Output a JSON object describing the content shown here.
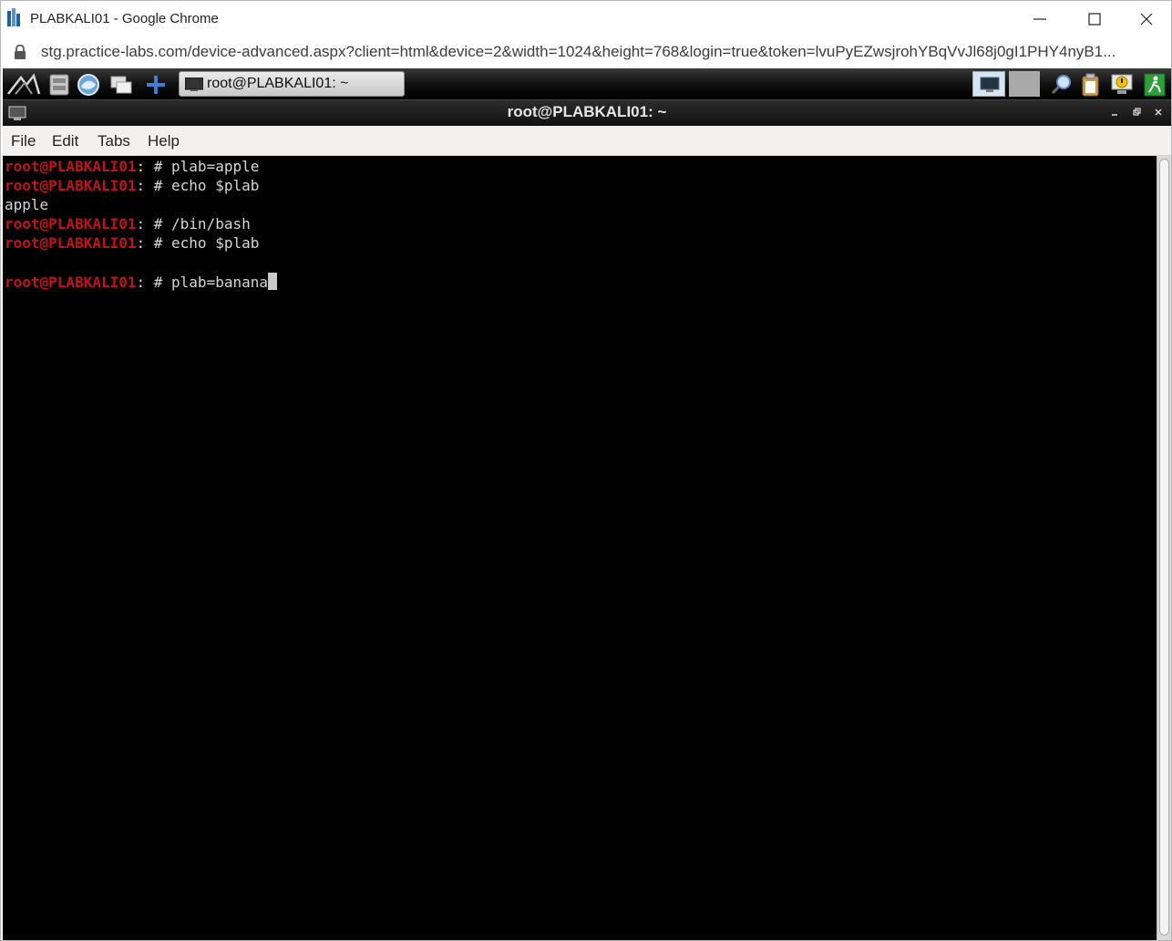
{
  "browser": {
    "window_title": "PLABKALI01 - Google Chrome",
    "url": "stg.practice-labs.com/device-advanced.aspx?client=html&device=2&width=1024&height=768&login=true&token=lvuPyEZwsjrohYBqVvJl68j0gI1PHY4nyB1..."
  },
  "taskbar": {
    "task_label": "root@PLABKALI01: ~",
    "icons": [
      "kali-menu-icon",
      "file-manager-icon",
      "browser-icon",
      "show-desktop-icon",
      "add-icon"
    ],
    "tray_icons": [
      "monitor-icon",
      "search-icon",
      "clipboard-icon",
      "alert-icon",
      "exit-icon"
    ]
  },
  "terminal_window": {
    "title": "root@PLABKALI01: ~",
    "menu": [
      "File",
      "Edit",
      "Tabs",
      "Help"
    ]
  },
  "terminal": {
    "lines": [
      {
        "prompt": "root@PLABKALI01",
        "sep": ": # ",
        "cmd": "plab=apple"
      },
      {
        "prompt": "root@PLABKALI01",
        "sep": ": # ",
        "cmd": "echo $plab"
      },
      {
        "prompt": "",
        "sep": "",
        "cmd": "apple"
      },
      {
        "prompt": "root@PLABKALI01",
        "sep": ": # ",
        "cmd": "/bin/bash"
      },
      {
        "prompt": "root@PLABKALI01",
        "sep": ": # ",
        "cmd": "echo $plab"
      },
      {
        "prompt": "",
        "sep": "",
        "cmd": ""
      },
      {
        "prompt": "root@PLABKALI01",
        "sep": ": # ",
        "cmd": "plab=banana"
      }
    ]
  },
  "colors": {
    "prompt": "#c1121a",
    "terminal_bg": "#000000",
    "terminal_fg": "#d6d6d6"
  }
}
